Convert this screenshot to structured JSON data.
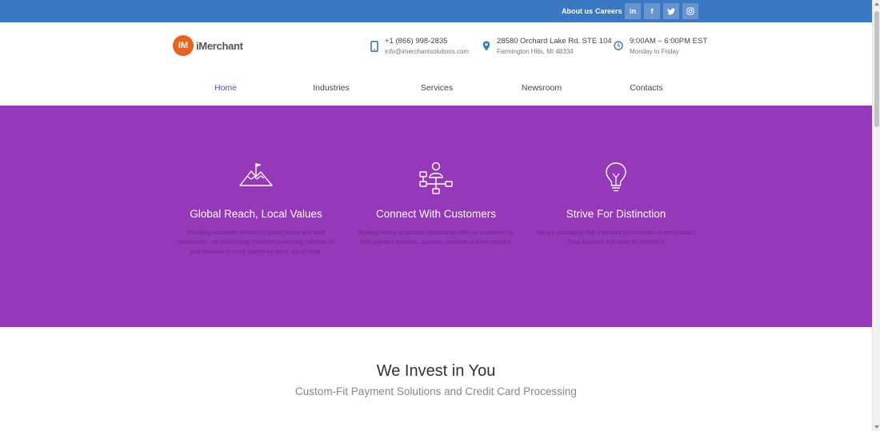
{
  "topbar": {
    "links": [
      "About us",
      "Careers"
    ],
    "social": [
      {
        "icon": "linkedin-icon",
        "glyph": "in"
      },
      {
        "icon": "facebook-icon",
        "glyph": "f"
      },
      {
        "icon": "twitter-icon",
        "glyph": "t"
      },
      {
        "icon": "instagram-icon",
        "glyph": "◎"
      }
    ]
  },
  "header": {
    "logo_mark": "iM",
    "logo_text": "iMerchant",
    "phone": {
      "line1": "+1 (866) 998-2835",
      "line2": "info@imerchantsolutions.com",
      "icon": "mobile-phone-icon"
    },
    "address": {
      "line1": "28580 Orchard Lake Rd. STE 104",
      "line2": "Farmington Hills, MI 48334",
      "icon": "map-pin-icon"
    },
    "hours": {
      "line1": "9:00AM – 6:00PM EST",
      "line2": "Monday to Friday",
      "icon": "clock-icon"
    }
  },
  "nav": {
    "items": [
      "Home",
      "Industries",
      "Services",
      "Newsroom",
      "Contacts"
    ],
    "active": "Home"
  },
  "features": [
    {
      "icon": "mountain-flag-icon",
      "title": "Global Reach, Local Values",
      "desc": "Providing worldwide services to global brands and local communities, we build lasting merchant processing solutions for your business in every market we serve, big or small."
    },
    {
      "icon": "network-person-icon",
      "title": "Connect With Customers",
      "desc": "Building lasting acquisition relationships with our customers so their payment networks, systems, providers and transactions."
    },
    {
      "icon": "lightbulb-icon",
      "title": "Strive For Distinction",
      "desc": "We are a company that is focused on innovation in every aspect of our business and strive for distinction."
    }
  ],
  "invest": {
    "title": "We Invest in You",
    "subtitle": "Custom-Fit Payment Solutions and Credit Card Processing"
  },
  "colors": {
    "topbar": "#3b78c4",
    "band": "#9538ba",
    "brand_orange": "#e8641e",
    "nav_active": "#3b5ea8"
  }
}
